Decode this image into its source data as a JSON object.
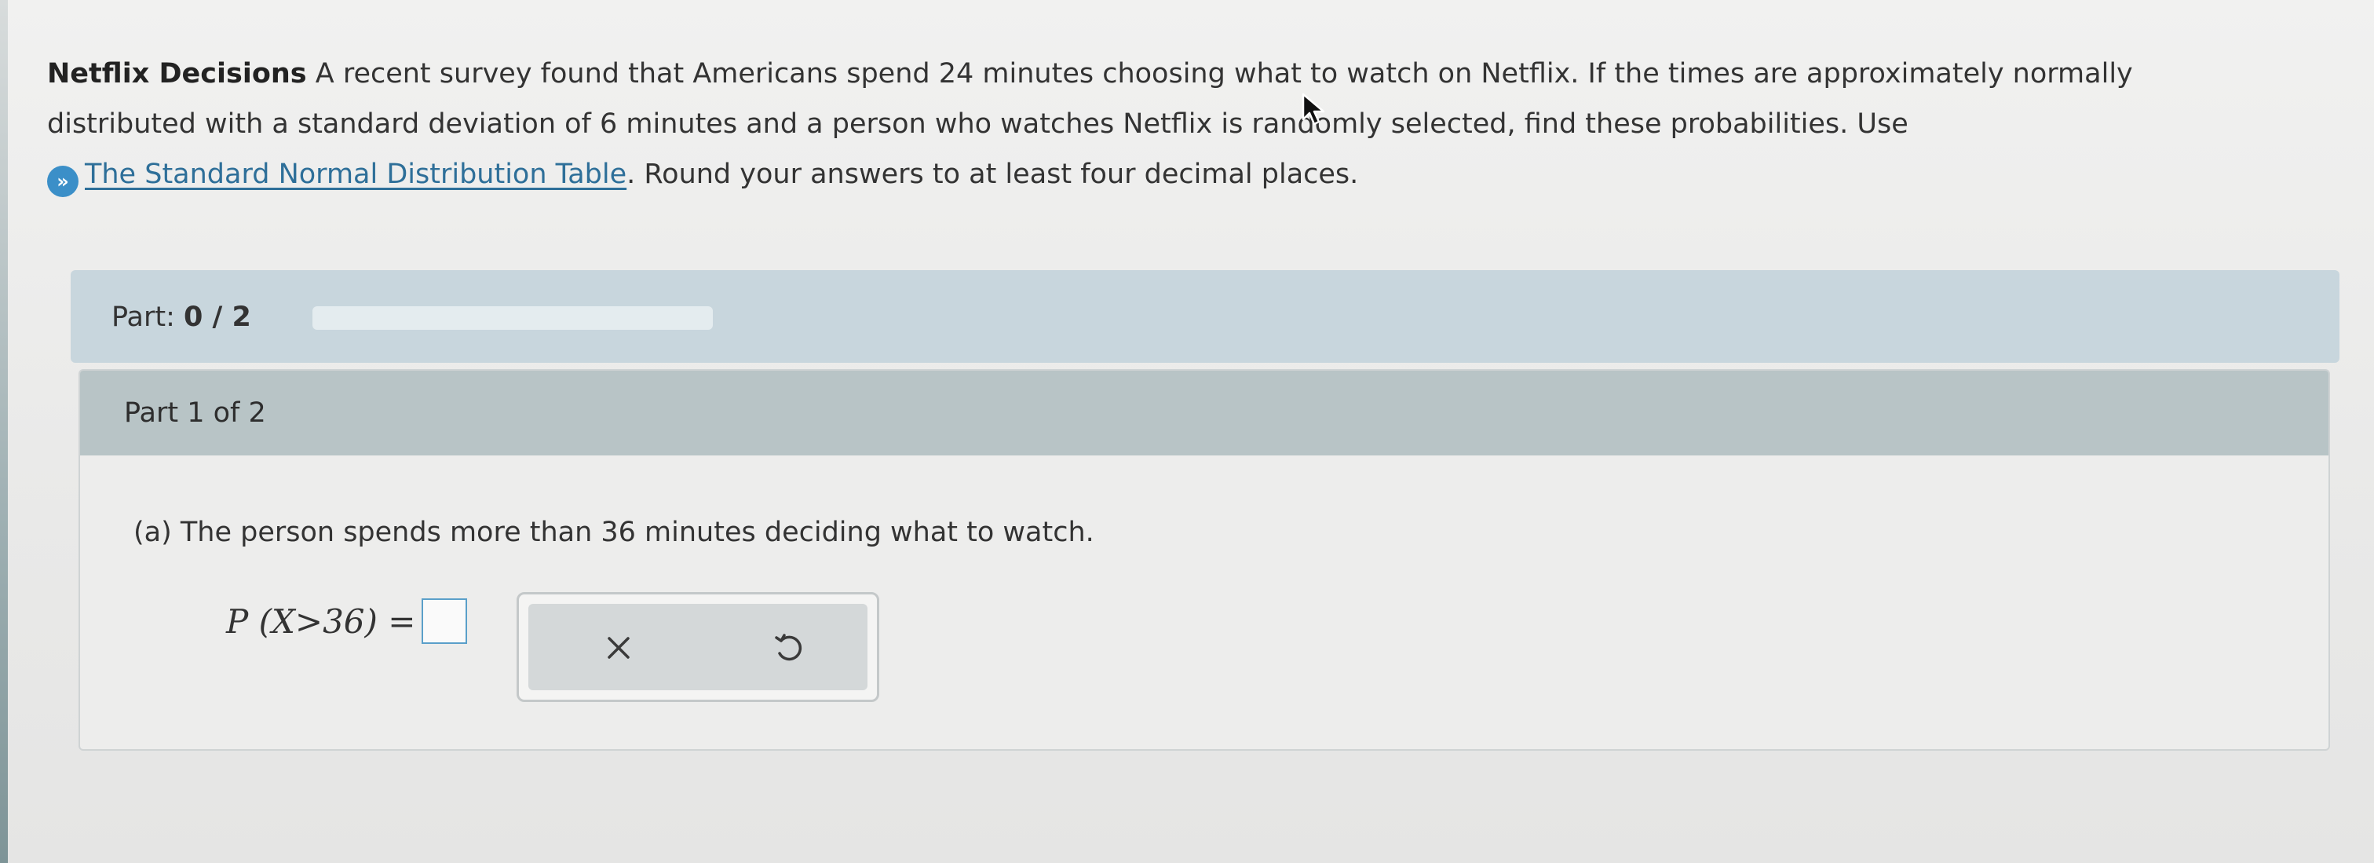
{
  "problem": {
    "title": "Netflix Decisions",
    "text_line1": " A recent survey found that Americans spend 24 minutes choosing what to watch on Netflix. If the times are approximately normally",
    "text_line2": "distributed with a standard deviation of 6 minutes and a person who watches Netflix is randomly selected, find these probabilities. Use",
    "help_link": "The Standard Normal Distribution Table",
    "text_line3_rest": ". Round your answers to at least four decimal places."
  },
  "progress": {
    "label": "Part: ",
    "value": "0 / 2",
    "fraction": 0
  },
  "part": {
    "header": "Part 1 of 2",
    "question": "(a) The person spends more than 36 minutes deciding what to watch.",
    "formula_lhs": "P (X>36) ="
  },
  "tools": {
    "clear": "x-icon",
    "undo": "undo-icon"
  },
  "colors": {
    "link": "#2e6f99",
    "accent": "#3b8fc8",
    "progress_bar": "#c8d6dd",
    "part_header": "#b8c4c6"
  }
}
